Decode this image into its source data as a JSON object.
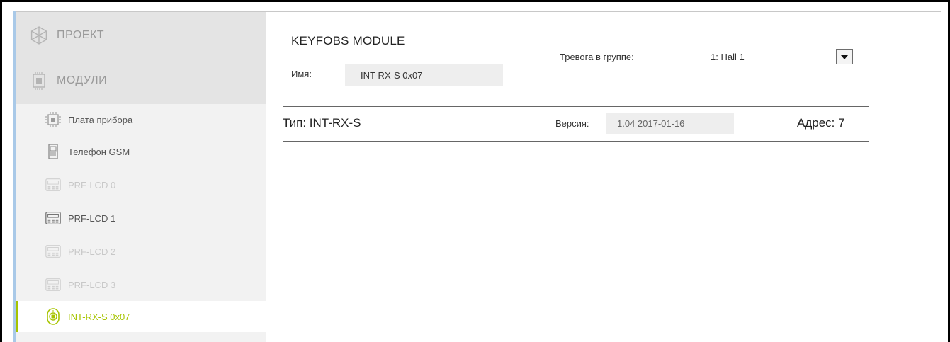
{
  "sidebar": {
    "sections": [
      {
        "label": "ПРОЕКТ",
        "icon": "project-icon"
      },
      {
        "label": "МОДУЛИ",
        "icon": "modules-icon"
      }
    ],
    "items": [
      {
        "label": "Плата прибора",
        "icon": "board-icon",
        "state": "normal"
      },
      {
        "label": "Телефон GSM",
        "icon": "phone-icon",
        "state": "normal"
      },
      {
        "label": "PRF-LCD 0",
        "icon": "keypad-icon",
        "state": "disabled"
      },
      {
        "label": "PRF-LCD 1",
        "icon": "keypad-icon",
        "state": "normal"
      },
      {
        "label": "PRF-LCD 2",
        "icon": "keypad-icon",
        "state": "disabled"
      },
      {
        "label": "PRF-LCD 3",
        "icon": "keypad-icon",
        "state": "disabled"
      },
      {
        "label": "INT-RX-S 0x07",
        "icon": "keyfob-icon",
        "state": "selected"
      }
    ]
  },
  "main": {
    "title": "KEYFOBS MODULE",
    "name_label": "Имя:",
    "name_value": "INT-RX-S 0x07",
    "alarm_label": "Тревога в группе:",
    "alarm_value": "1: Hall 1",
    "type_label": "Тип: INT-RX-S",
    "version_label": "Версия:",
    "version_value": "1.04 2017-01-16",
    "address_label": "Адрес: 7"
  },
  "colors": {
    "accent": "#a7c400",
    "sidebar_bg": "#f2f2f2",
    "sidebar_header_bg": "#e4e4e4",
    "field_bg": "#eeeeee"
  }
}
